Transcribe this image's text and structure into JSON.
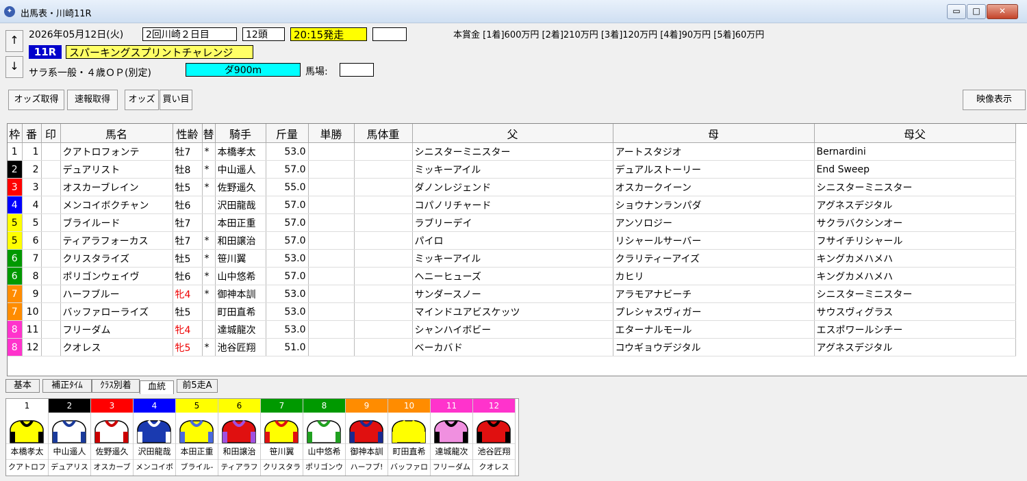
{
  "window": {
    "title": "出馬表・川崎11R",
    "min": "▭",
    "max": "□",
    "close": "✕"
  },
  "race": {
    "date": "2026年05月12日(火)",
    "meeting": "2回川崎２日目",
    "runners": "12頭",
    "post_time": "20:15発走",
    "race_no": "11R",
    "race_name": "スパーキングスプリントチャレンジ",
    "conditions": "サラ系一般・４歳ＯＰ(別定)",
    "course": "ダ900m",
    "going_label": "馬場:",
    "going_value": "",
    "extra_value": "",
    "prize": "本賞金 [1着]600万円 [2着]210万円 [3着]120万円 [4着]90万円 [5着]60万円"
  },
  "nav": {
    "up": "↑",
    "down": "↓"
  },
  "toolbar": {
    "odds_fetch": "オッズ取得",
    "flash_fetch": "速報取得",
    "odds": "オッズ",
    "bets": "買い目",
    "video": "映像表示"
  },
  "columns": [
    "枠",
    "番",
    "印",
    "馬名",
    "性齢",
    "替",
    "騎手",
    "斤量",
    "単勝",
    "馬体重",
    "父",
    "母",
    "母父"
  ],
  "rows": [
    {
      "waku": "1",
      "num": "1",
      "mark": "",
      "horse": "クアトロフォンテ",
      "sexage": "牡7",
      "change": "*",
      "jockey": "本橋孝太",
      "weight": "53.0",
      "odds": "",
      "bw": "",
      "sire": "シニスターミニスター",
      "dam": "アートスタジオ",
      "damsire": "Bernardini"
    },
    {
      "waku": "2",
      "num": "2",
      "mark": "",
      "horse": "デュアリスト",
      "sexage": "牡8",
      "change": "*",
      "jockey": "中山遥人",
      "weight": "57.0",
      "odds": "",
      "bw": "",
      "sire": "ミッキーアイル",
      "dam": "デュアルストーリー",
      "damsire": "End Sweep"
    },
    {
      "waku": "3",
      "num": "3",
      "mark": "",
      "horse": "オスカーブレイン",
      "sexage": "牡5",
      "change": "*",
      "jockey": "佐野遥久",
      "weight": "55.0",
      "odds": "",
      "bw": "",
      "sire": "ダノンレジェンド",
      "dam": "オスカークイーン",
      "damsire": "シニスターミニスター"
    },
    {
      "waku": "4",
      "num": "4",
      "mark": "",
      "horse": "メンコイボクチャン",
      "sexage": "牡6",
      "change": "",
      "jockey": "沢田龍哉",
      "weight": "57.0",
      "odds": "",
      "bw": "",
      "sire": "コパノリチャード",
      "dam": "ショウナンランパダ",
      "damsire": "アグネスデジタル"
    },
    {
      "waku": "5",
      "num": "5",
      "mark": "",
      "horse": "ブライルード",
      "sexage": "牡7",
      "change": "",
      "jockey": "本田正重",
      "weight": "57.0",
      "odds": "",
      "bw": "",
      "sire": "ラブリーデイ",
      "dam": "アンソロジー",
      "damsire": "サクラバクシンオー"
    },
    {
      "waku": "5",
      "num": "6",
      "mark": "",
      "horse": "ティアラフォーカス",
      "sexage": "牡7",
      "change": "*",
      "jockey": "和田譲治",
      "weight": "57.0",
      "odds": "",
      "bw": "",
      "sire": "パイロ",
      "dam": "リシャールサーバー",
      "damsire": "フサイチリシャール"
    },
    {
      "waku": "6",
      "num": "7",
      "mark": "",
      "horse": "クリスタライズ",
      "sexage": "牡5",
      "change": "*",
      "jockey": "笹川翼",
      "weight": "53.0",
      "odds": "",
      "bw": "",
      "sire": "ミッキーアイル",
      "dam": "クラリティーアイズ",
      "damsire": "キングカメハメハ"
    },
    {
      "waku": "6",
      "num": "8",
      "mark": "",
      "horse": "ポリゴンウェイヴ",
      "sexage": "牡6",
      "change": "*",
      "jockey": "山中悠希",
      "weight": "57.0",
      "odds": "",
      "bw": "",
      "sire": "ヘニーヒューズ",
      "dam": "カヒリ",
      "damsire": "キングカメハメハ"
    },
    {
      "waku": "7",
      "num": "9",
      "mark": "",
      "horse": "ハーフブルー",
      "sexage": "牝4",
      "change": "*",
      "jockey": "御神本訓",
      "weight": "53.0",
      "odds": "",
      "bw": "",
      "sire": "サンダースノー",
      "dam": "アラモアナビーチ",
      "damsire": "シニスターミニスター"
    },
    {
      "waku": "7",
      "num": "10",
      "mark": "",
      "horse": "バッファローライズ",
      "sexage": "牡5",
      "change": "",
      "jockey": "町田直希",
      "weight": "53.0",
      "odds": "",
      "bw": "",
      "sire": "マインドユアビスケッツ",
      "dam": "プレシャスヴィガー",
      "damsire": "サウスヴィグラス"
    },
    {
      "waku": "8",
      "num": "11",
      "mark": "",
      "horse": "フリーダム",
      "sexage": "牝4",
      "change": "",
      "jockey": "達城龍次",
      "weight": "53.0",
      "odds": "",
      "bw": "",
      "sire": "シャンハイボビー",
      "dam": "エターナルモール",
      "damsire": "エスポワールシチー"
    },
    {
      "waku": "8",
      "num": "12",
      "mark": "",
      "horse": "クオレス",
      "sexage": "牝5",
      "change": "*",
      "jockey": "池谷匠翔",
      "weight": "51.0",
      "odds": "",
      "bw": "",
      "sire": "ベーカバド",
      "dam": "コウギョウデジタル",
      "damsire": "アグネスデジタル"
    }
  ],
  "tabs": [
    "基本",
    "補正ﾀｲﾑ",
    "ｸﾗｽ別着",
    "血統",
    "前5走A"
  ],
  "silks": [
    {
      "num": "1",
      "jockey": "本橋孝太",
      "horse": "クアトロフ"
    },
    {
      "num": "2",
      "jockey": "中山遥人",
      "horse": "デュアリス"
    },
    {
      "num": "3",
      "jockey": "佐野遥久",
      "horse": "オスカーブ"
    },
    {
      "num": "4",
      "jockey": "沢田龍哉",
      "horse": "メンコイボ"
    },
    {
      "num": "5",
      "jockey": "本田正重",
      "horse": "ブライル-"
    },
    {
      "num": "6",
      "jockey": "和田譲治",
      "horse": "ティアラフ"
    },
    {
      "num": "7",
      "jockey": "笹川翼",
      "horse": "クリスタラ"
    },
    {
      "num": "8",
      "jockey": "山中悠希",
      "horse": "ポリゴンウ"
    },
    {
      "num": "9",
      "jockey": "御神本訓",
      "horse": "ハーフブ!"
    },
    {
      "num": "10",
      "jockey": "町田直希",
      "horse": "バッファロ"
    },
    {
      "num": "11",
      "jockey": "達城龍次",
      "horse": "フリーダム"
    },
    {
      "num": "12",
      "jockey": "池谷匠翔",
      "horse": "クオレス"
    }
  ],
  "colors": {
    "waku": {
      "1": "#ffffff",
      "2": "#000000",
      "3": "#ff0000",
      "4": "#0000ff",
      "5": "#ffff00",
      "6": "#009900",
      "7": "#ff8c00",
      "8": "#ff33cc"
    },
    "waku_text": {
      "1": "#000000",
      "2": "#ffffff",
      "3": "#ffffff",
      "4": "#ffffff",
      "5": "#000000",
      "6": "#ffffff",
      "7": "#ffffff",
      "8": "#ffffff"
    },
    "silk_hdr": {
      "1": "#ffffff",
      "2": "#000000",
      "3": "#ff0000",
      "4": "#0000ff",
      "5": "#ffff00",
      "6": "#ffff00",
      "7": "#009900",
      "8": "#009900",
      "9": "#ff8c00",
      "10": "#ff8c00",
      "11": "#ff33cc",
      "12": "#ff33cc"
    },
    "race_no_bg": "#0000cc",
    "race_name_bg": "#ffff66",
    "course_bg": "#00ffff",
    "post_time_bg": "#ffff00",
    "female": "#ee0000"
  },
  "icons": {
    "app": "horse-racing-app-icon"
  }
}
